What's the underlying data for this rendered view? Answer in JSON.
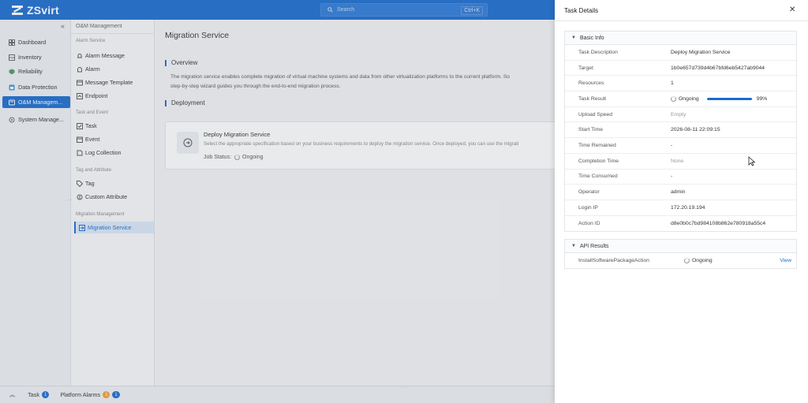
{
  "app": {
    "name": "ZSvirt",
    "search_placeholder": "Search",
    "search_shortcut": "Ctrl+K"
  },
  "nav": {
    "items": [
      {
        "label": "Dashboard",
        "icon": "dashboard-icon"
      },
      {
        "label": "Inventory",
        "icon": "inventory-icon"
      },
      {
        "label": "Reliability",
        "icon": "reliability-icon"
      },
      {
        "label": "Data Protection",
        "icon": "data-protection-icon"
      },
      {
        "label": "O&M Managem...",
        "icon": "om-icon",
        "active": true
      },
      {
        "label": "System Manage...",
        "icon": "system-icon"
      }
    ]
  },
  "subnav": {
    "header": "O&M Management",
    "groups": [
      {
        "label": "Alarm Service",
        "items": [
          "Alarm Message",
          "Alarm",
          "Message Template",
          "Endpoint"
        ]
      },
      {
        "label": "Task and Event",
        "items": [
          "Task",
          "Event",
          "Log Collection"
        ]
      },
      {
        "label": "Tag and Attribute",
        "items": [
          "Tag",
          "Custom Attribute"
        ]
      },
      {
        "label": "Migration Management",
        "items": [
          "Migration Service"
        ]
      }
    ],
    "active": "Migration Service"
  },
  "main": {
    "title": "Migration Service",
    "overview_title": "Overview",
    "overview_line1": "The migration service enables complete migration of virtual machine systems and data from other virtualization platforms to the current platform. So",
    "overview_line2": "step-by-step wizard guides you through the end-to-end migration process.",
    "deployment_title": "Deployment",
    "card": {
      "title": "Deploy Migration Service",
      "description": "Select the appropriate specification based on your business requirements to deploy the migration service. Once deployed, you can use the migrati",
      "status_label": "Job Status:",
      "status_value": "Ongoing"
    }
  },
  "footer": {
    "task_label": "Task",
    "task_count": "1",
    "alarms_label": "Platform Alarms",
    "alarms_count_a": "1",
    "alarms_count_b": "1"
  },
  "drawer": {
    "title": "Task Details",
    "basic_info": {
      "header": "Basic Info",
      "rows": [
        {
          "key": "Task Description",
          "value": "Deploy Migration Service"
        },
        {
          "key": "Target",
          "value": "1b0e657d739d4b67bfd6eb5427ab9044"
        },
        {
          "key": "Resources",
          "value": "1"
        },
        {
          "key": "Task Result",
          "value": "Ongoing",
          "progress": 0.99,
          "progress_text": "99%"
        },
        {
          "key": "Upload Speed",
          "value": "Empty",
          "muted": true
        },
        {
          "key": "Start Time",
          "value": "2026-08-11 22:09:15"
        },
        {
          "key": "Time Remained",
          "value": "-"
        },
        {
          "key": "Completion Time",
          "value": "None",
          "muted": true
        },
        {
          "key": "Time Consumed",
          "value": "-"
        },
        {
          "key": "Operator",
          "value": "admin"
        },
        {
          "key": "Login IP",
          "value": "172.20.19.194"
        },
        {
          "key": "Action ID",
          "value": "d8e0b0c7bd984108b862e780918a55c4"
        }
      ]
    },
    "api_results": {
      "header": "API Results",
      "rows": [
        {
          "key": "InstallSoftwarePackageAction",
          "status": "Ongoing",
          "link": "View"
        }
      ]
    }
  },
  "colors": {
    "brand": "#1a6ccf",
    "progress": "#1a6ccf",
    "alarm_orange": "#f0a030"
  }
}
